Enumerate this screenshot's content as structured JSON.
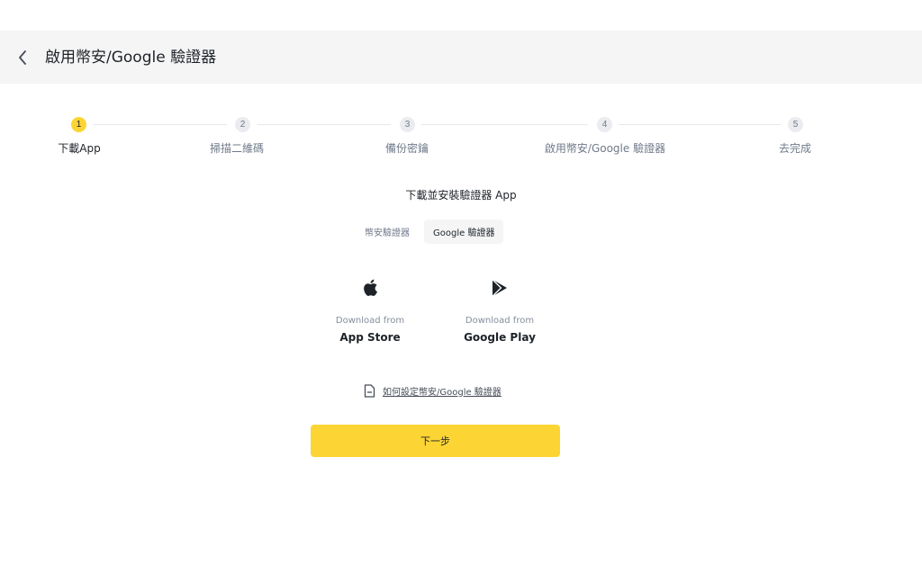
{
  "header": {
    "title": "啟用幣安/Google 驗證器"
  },
  "stepper": {
    "steps": [
      {
        "number": "1",
        "label": "下載App",
        "active": true
      },
      {
        "number": "2",
        "label": "掃描二維碼",
        "active": false
      },
      {
        "number": "3",
        "label": "備份密鑰",
        "active": false
      },
      {
        "number": "4",
        "label": "啟用幣安/Google 驗證器",
        "active": false
      },
      {
        "number": "5",
        "label": "去完成",
        "active": false
      }
    ]
  },
  "main": {
    "subtitle": "下載並安裝驗證器 App",
    "tabs": [
      {
        "label": "幣安驗證器",
        "active": false
      },
      {
        "label": "Google 驗證器",
        "active": true
      }
    ],
    "stores": [
      {
        "from": "Download from",
        "name": "App Store",
        "icon": "apple-icon"
      },
      {
        "from": "Download from",
        "name": "Google Play",
        "icon": "google-play-icon"
      }
    ],
    "howto_link": "如何設定幣安/Google 驗證器",
    "next_button": "下一步"
  },
  "colors": {
    "accent": "#fcd535",
    "header_bg": "#f5f5f5",
    "text_primary": "#1e2329",
    "text_secondary": "#707a8a"
  }
}
